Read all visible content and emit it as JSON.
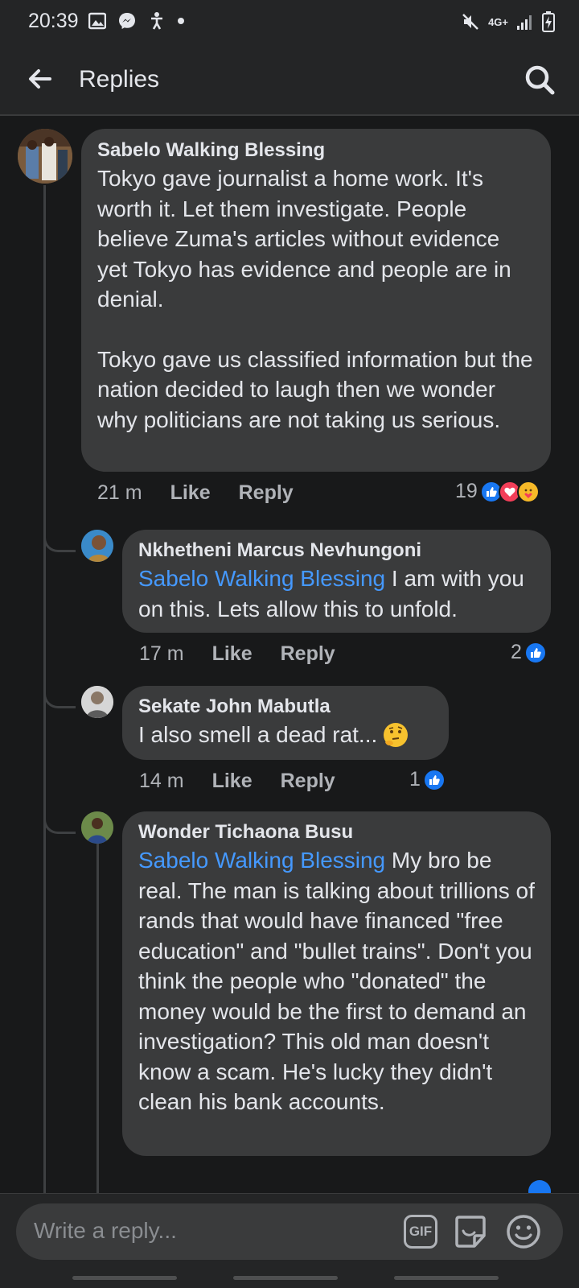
{
  "status_bar": {
    "time": "20:39",
    "left_icons": [
      "image-icon",
      "messenger-icon",
      "accessibility-icon",
      "dot-icon"
    ],
    "right_icons": [
      "mute-icon",
      "4g-icon",
      "signal-icon",
      "battery-icon"
    ],
    "network_label": "4G+"
  },
  "header": {
    "title": "Replies",
    "back_icon": "back-arrow-icon",
    "search_icon": "search-icon"
  },
  "comments": [
    {
      "author": "Sabelo Walking Blessing",
      "paragraphs": [
        "Tokyo gave journalist a home work. It's worth it. Let them investigate. People believe Zuma's articles without evidence yet Tokyo has evidence and people are in denial.",
        "Tokyo gave us classified information but the nation decided to laugh then we wonder why politicians are not taking us serious."
      ],
      "time": "21 m",
      "like_label": "Like",
      "reply_label": "Reply",
      "reaction_count": "19",
      "reactions": [
        "like-icon",
        "love-icon",
        "care-icon"
      ]
    },
    {
      "author": "Nkhetheni Marcus Nevhungoni",
      "mention": "Sabelo Walking Blessing",
      "text": " I am with you on this. Lets allow this to unfold.",
      "time": "17 m",
      "like_label": "Like",
      "reply_label": "Reply",
      "reaction_count": "2",
      "reactions": [
        "like-icon"
      ]
    },
    {
      "author": "Sekate John Mabutla",
      "text": "I also smell a dead rat...",
      "emoji": "thinking-face-icon",
      "time": "14 m",
      "like_label": "Like",
      "reply_label": "Reply",
      "reaction_count": "1",
      "reactions": [
        "like-icon"
      ]
    },
    {
      "author": "Wonder Tichaona Busu",
      "mention": "Sabelo Walking Blessing",
      "text": " My bro be real. The man is talking about trillions of rands that would have financed \"free education\" and \"bullet trains\". Don't you think the people who \"donated\" the money would be the first to demand an investigation? This old man doesn't know a scam. He's lucky they didn't clean his bank accounts."
    }
  ],
  "composer": {
    "placeholder": "Write a reply...",
    "gif_label": "GIF",
    "sticker_icon": "sticker-icon",
    "emoji_icon": "smiley-icon"
  },
  "colors": {
    "background": "#18191a",
    "bubble": "#3a3b3c",
    "mention": "#4599ff",
    "like_blue": "#1877f2",
    "love_red": "#f33e58"
  }
}
